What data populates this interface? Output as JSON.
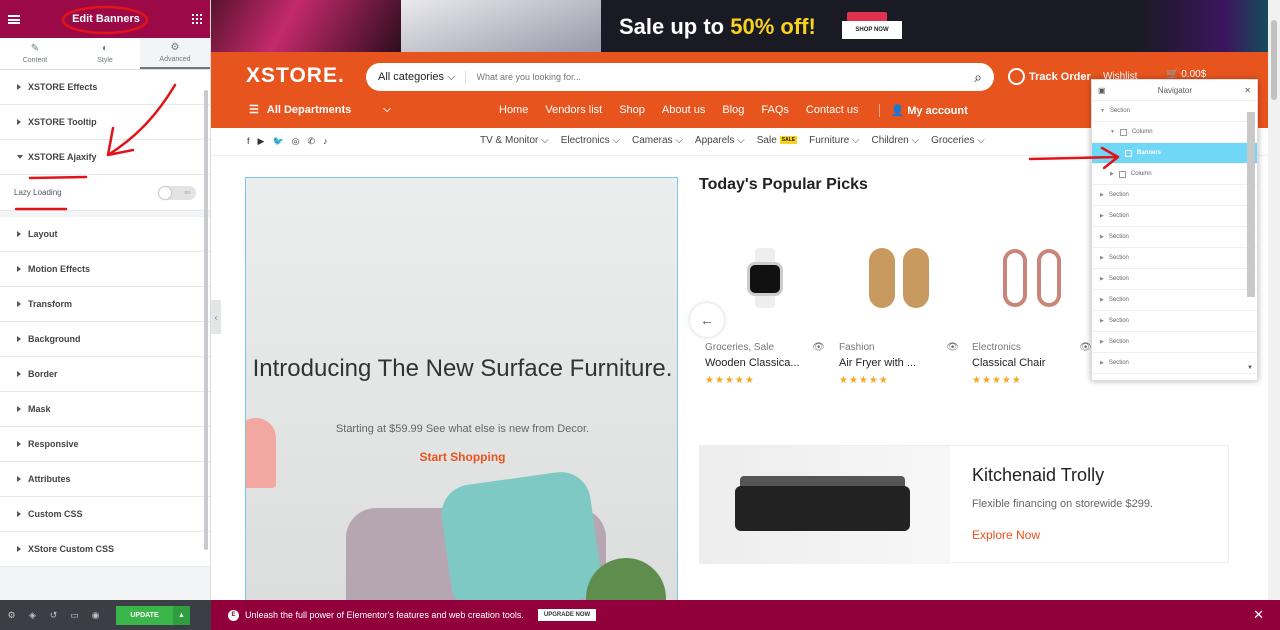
{
  "editor": {
    "title": "Edit Banners",
    "tabs": [
      {
        "label": "Content",
        "icon": "pencil-icon"
      },
      {
        "label": "Style",
        "icon": "contrast-icon"
      },
      {
        "label": "Advanced",
        "icon": "gear-icon"
      }
    ],
    "sections": [
      "XSTORE Effects",
      "XSTORE Tooltip",
      "XSTORE Ajaxify",
      "Layout",
      "Motion Effects",
      "Transform",
      "Background",
      "Border",
      "Mask",
      "Responsive",
      "Attributes",
      "Custom CSS",
      "XStore Custom CSS"
    ],
    "lazy_loading_label": "Lazy Loading",
    "lazy_loading_toggle": "no",
    "update_label": "UPDATE",
    "accent_color": "#9b0a46"
  },
  "promo": {
    "text_before": "Sale up to ",
    "text_highlight": "50% off!",
    "shop_now": "SHOP NOW"
  },
  "header": {
    "logo": "XSTORE.",
    "category_select": "All categories",
    "search_placeholder": "What are you looking for...",
    "track_order": "Track Order",
    "wishlist": "Wishlist",
    "cart_amount": "0.00$",
    "all_departments": "All Departments",
    "nav": [
      "Home",
      "Vendors list",
      "Shop",
      "About us",
      "Blog",
      "FAQs",
      "Contact us"
    ],
    "my_account": "My account",
    "brand_color": "#e8541e"
  },
  "category_bar": {
    "social": [
      "facebook-icon",
      "youtube-icon",
      "twitter-icon",
      "instagram-icon",
      "whatsapp-icon",
      "tiktok-icon"
    ],
    "items": [
      "TV & Monitor",
      "Electronics",
      "Cameras",
      "Apparels",
      "Sale",
      "Furniture",
      "Children",
      "Groceries"
    ],
    "sale_badge": "SALE"
  },
  "hero": {
    "title": "Introducing The New Surface Furniture.",
    "subtitle": "Starting at $59.99 See what else is new from Decor.",
    "link": "Start Shopping"
  },
  "popular": {
    "title": "Today's Popular Picks",
    "products": [
      {
        "category": "Groceries, Sale",
        "name": "Wooden Classica...",
        "stars": "★★★★★"
      },
      {
        "category": "Fashion",
        "name": "Air Fryer with ...",
        "stars": "★★★★★"
      },
      {
        "category": "Electronics",
        "name": "Classical Chair",
        "stars": "★★★★★"
      }
    ]
  },
  "banner2": {
    "title": "Kitchenaid Trolly",
    "subtitle": "Flexible financing on storewide $299.",
    "link": "Explore Now"
  },
  "navigator": {
    "title": "Navigator",
    "rows": [
      {
        "label": "Section",
        "level": 0,
        "type": "section",
        "state": "open"
      },
      {
        "label": "Column",
        "level": 1,
        "type": "column",
        "state": "open"
      },
      {
        "label": "Banners",
        "level": 2,
        "type": "widget",
        "state": "selected"
      },
      {
        "label": "Column",
        "level": 1,
        "type": "column",
        "state": "closed"
      },
      {
        "label": "Section",
        "level": 0,
        "type": "section",
        "state": "closed"
      },
      {
        "label": "Section",
        "level": 0,
        "type": "section",
        "state": "closed"
      },
      {
        "label": "Section",
        "level": 0,
        "type": "section",
        "state": "closed"
      },
      {
        "label": "Section",
        "level": 0,
        "type": "section",
        "state": "closed"
      },
      {
        "label": "Section",
        "level": 0,
        "type": "section",
        "state": "closed"
      },
      {
        "label": "Section",
        "level": 0,
        "type": "section",
        "state": "closed"
      },
      {
        "label": "Section",
        "level": 0,
        "type": "section",
        "state": "closed"
      },
      {
        "label": "Section",
        "level": 0,
        "type": "section",
        "state": "closed"
      },
      {
        "label": "Section",
        "level": 0,
        "type": "section",
        "state": "closed"
      }
    ]
  },
  "bottom_bar": {
    "message": "Unleash the full power of Elementor's features and web creation tools.",
    "upgrade": "UPGRADE NOW",
    "color": "#92003b"
  }
}
